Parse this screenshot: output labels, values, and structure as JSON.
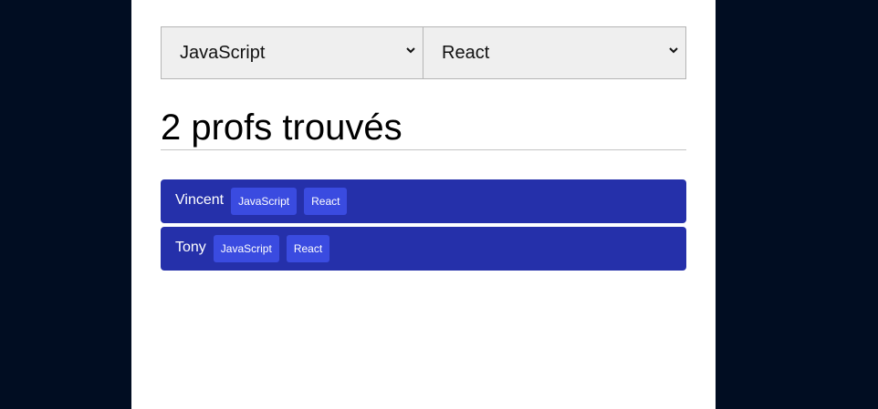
{
  "filters": {
    "language": {
      "selected": "JavaScript"
    },
    "framework": {
      "selected": "React"
    }
  },
  "results": {
    "title": "2 profs trouvés",
    "items": [
      {
        "name": "Vincent",
        "tags": [
          "JavaScript",
          "React"
        ]
      },
      {
        "name": "Tony",
        "tags": [
          "JavaScript",
          "React"
        ]
      }
    ]
  },
  "colors": {
    "background": "#010d22",
    "row": "#2530aa",
    "tag": "#3a4be0"
  },
  "icons": {
    "select_arrow": "chevron-down-icon"
  }
}
